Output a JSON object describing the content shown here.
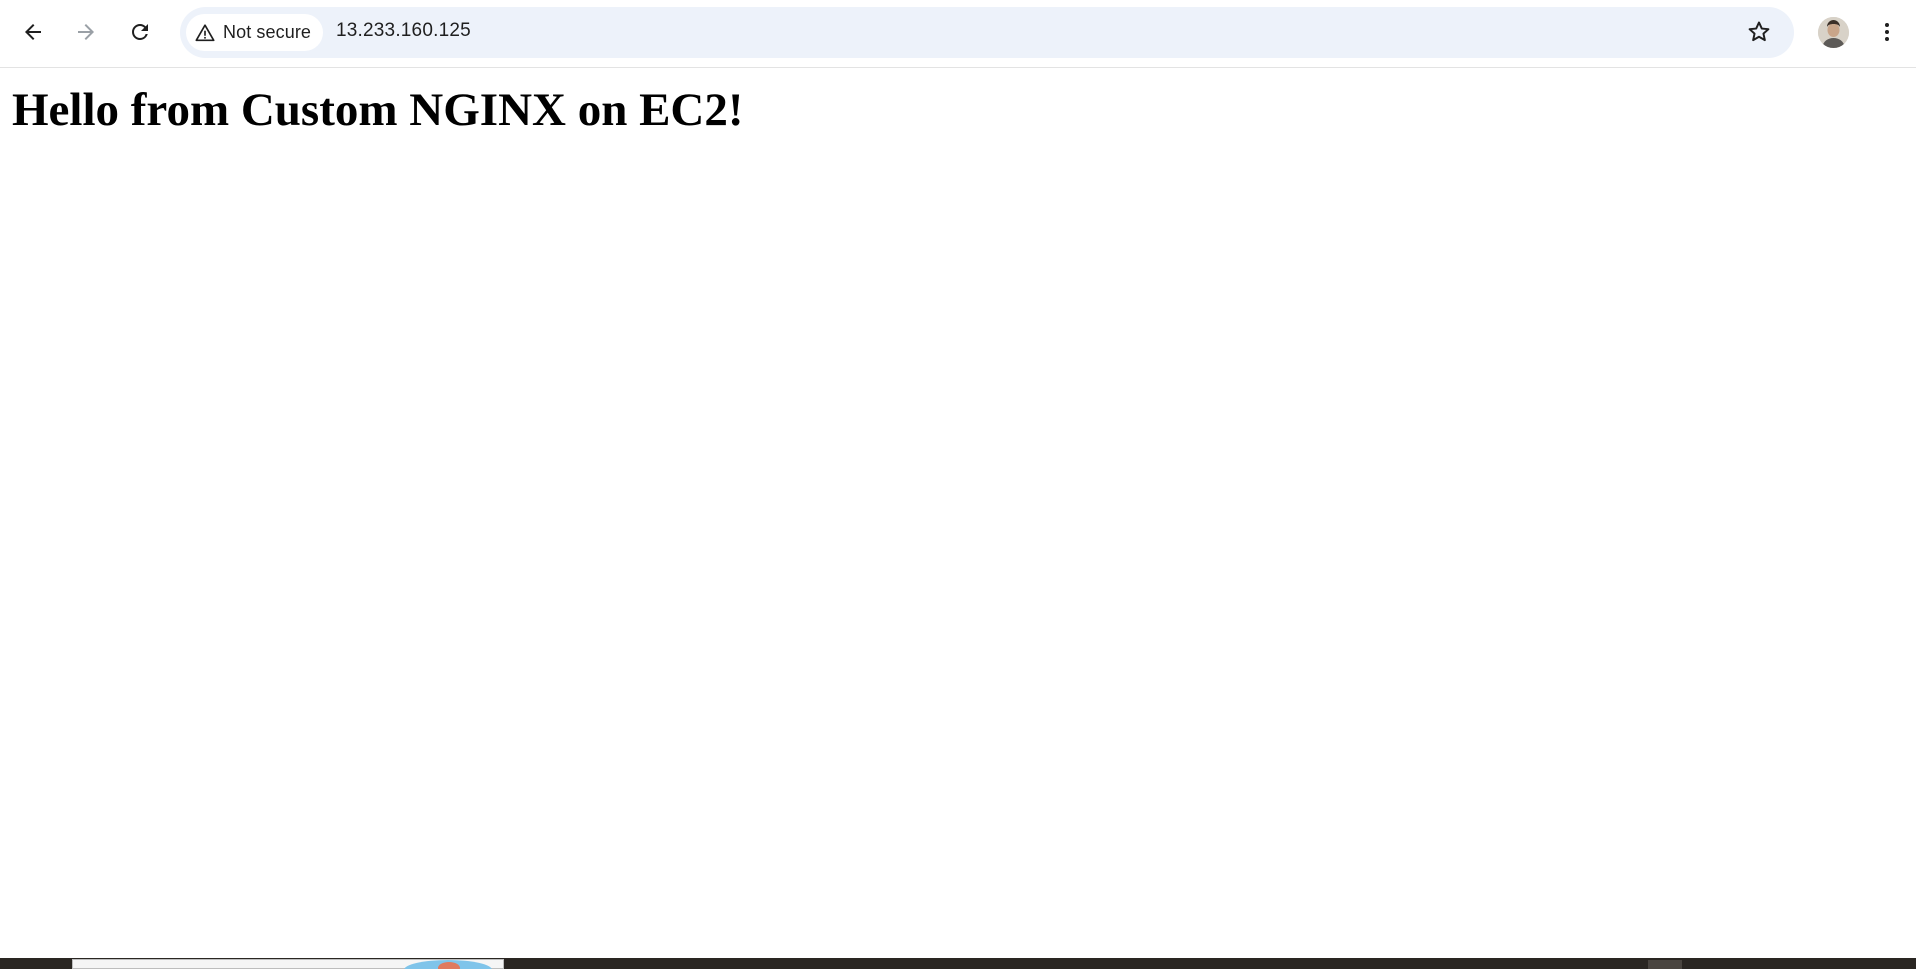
{
  "browser": {
    "nav": {
      "back_icon": "arrow-left-icon",
      "forward_icon": "arrow-right-icon",
      "reload_icon": "reload-icon"
    },
    "omnibox": {
      "security_label": "Not secure",
      "security_icon": "warning-triangle-icon",
      "url": "13.233.160.125",
      "bookmark_icon": "star-outline-icon"
    },
    "profile_icon": "avatar",
    "menu_icon": "kebab-menu-icon",
    "colors": {
      "omnibox_bg": "#edf2fa",
      "text": "#1f1f1f",
      "forward_disabled": "#9aa0a6"
    }
  },
  "page": {
    "heading": "Hello from Custom NGINX on EC2!"
  }
}
